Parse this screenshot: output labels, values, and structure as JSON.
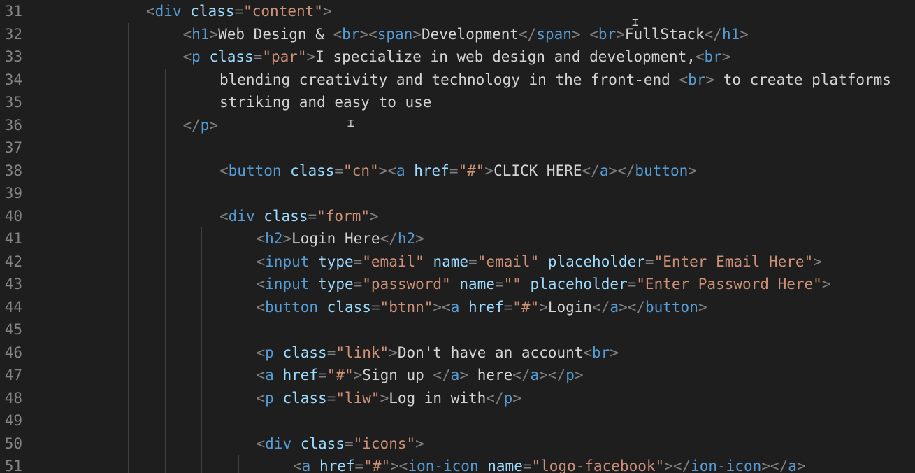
{
  "editor": {
    "colors": {
      "background": "#1e1e1e",
      "line_number": "#858585",
      "punctuation": "#808080",
      "tag": "#569cd6",
      "attribute": "#9cdcfe",
      "string": "#ce9178",
      "text": "#d4d4d4"
    },
    "lines": [
      {
        "num": "31",
        "indent": 3,
        "tokens": [
          {
            "t": "t",
            "v": "<"
          },
          {
            "t": "tg",
            "v": "div"
          },
          {
            "t": "tx",
            "v": " "
          },
          {
            "t": "at",
            "v": "class"
          },
          {
            "t": "t",
            "v": "="
          },
          {
            "t": "st",
            "v": "\"content\""
          },
          {
            "t": "t",
            "v": ">"
          }
        ]
      },
      {
        "num": "32",
        "indent": 4,
        "tokens": [
          {
            "t": "t",
            "v": "<"
          },
          {
            "t": "tg",
            "v": "h1"
          },
          {
            "t": "t",
            "v": ">"
          },
          {
            "t": "tx",
            "v": "Web Design & "
          },
          {
            "t": "t",
            "v": "<"
          },
          {
            "t": "tg",
            "v": "br"
          },
          {
            "t": "t",
            "v": ">"
          },
          {
            "t": "t",
            "v": "<"
          },
          {
            "t": "tg",
            "v": "span"
          },
          {
            "t": "t",
            "v": ">"
          },
          {
            "t": "tx",
            "v": "Development"
          },
          {
            "t": "t",
            "v": "</"
          },
          {
            "t": "tg",
            "v": "span"
          },
          {
            "t": "t",
            "v": ">"
          },
          {
            "t": "tx",
            "v": " "
          },
          {
            "t": "t",
            "v": "<"
          },
          {
            "t": "tg",
            "v": "br"
          },
          {
            "t": "t",
            "v": ">"
          },
          {
            "t": "tx",
            "v": "FullStack"
          },
          {
            "t": "t",
            "v": "</"
          },
          {
            "t": "tg",
            "v": "h1"
          },
          {
            "t": "t",
            "v": ">"
          }
        ]
      },
      {
        "num": "33",
        "indent": 4,
        "tokens": [
          {
            "t": "t",
            "v": "<"
          },
          {
            "t": "tg",
            "v": "p"
          },
          {
            "t": "tx",
            "v": " "
          },
          {
            "t": "at",
            "v": "class"
          },
          {
            "t": "t",
            "v": "="
          },
          {
            "t": "st",
            "v": "\"par\""
          },
          {
            "t": "t",
            "v": ">"
          },
          {
            "t": "tx",
            "v": "I specialize in web design and development,"
          },
          {
            "t": "t",
            "v": "<"
          },
          {
            "t": "tg",
            "v": "br"
          },
          {
            "t": "t",
            "v": ">"
          }
        ]
      },
      {
        "num": "34",
        "indent": 5,
        "tokens": [
          {
            "t": "tx",
            "v": "blending creativity and technology in the front-end "
          },
          {
            "t": "t",
            "v": "<"
          },
          {
            "t": "tg",
            "v": "br"
          },
          {
            "t": "t",
            "v": ">"
          },
          {
            "t": "tx",
            "v": " to create platforms"
          }
        ]
      },
      {
        "num": "35",
        "indent": 5,
        "tokens": [
          {
            "t": "tx",
            "v": "striking and easy to use"
          }
        ]
      },
      {
        "num": "36",
        "indent": 4,
        "tokens": [
          {
            "t": "t",
            "v": "</"
          },
          {
            "t": "tg",
            "v": "p"
          },
          {
            "t": "t",
            "v": ">"
          }
        ]
      },
      {
        "num": "37",
        "indent": 0,
        "tokens": []
      },
      {
        "num": "38",
        "indent": 5,
        "tokens": [
          {
            "t": "t",
            "v": "<"
          },
          {
            "t": "tg",
            "v": "button"
          },
          {
            "t": "tx",
            "v": " "
          },
          {
            "t": "at",
            "v": "class"
          },
          {
            "t": "t",
            "v": "="
          },
          {
            "t": "st",
            "v": "\"cn\""
          },
          {
            "t": "t",
            "v": ">"
          },
          {
            "t": "t",
            "v": "<"
          },
          {
            "t": "tg",
            "v": "a"
          },
          {
            "t": "tx",
            "v": " "
          },
          {
            "t": "at",
            "v": "href"
          },
          {
            "t": "t",
            "v": "="
          },
          {
            "t": "st",
            "v": "\"#\""
          },
          {
            "t": "t",
            "v": ">"
          },
          {
            "t": "tx",
            "v": "CLICK HERE"
          },
          {
            "t": "t",
            "v": "</"
          },
          {
            "t": "tg",
            "v": "a"
          },
          {
            "t": "t",
            "v": ">"
          },
          {
            "t": "t",
            "v": "</"
          },
          {
            "t": "tg",
            "v": "button"
          },
          {
            "t": "t",
            "v": ">"
          }
        ]
      },
      {
        "num": "39",
        "indent": 0,
        "tokens": []
      },
      {
        "num": "40",
        "indent": 5,
        "tokens": [
          {
            "t": "t",
            "v": "<"
          },
          {
            "t": "tg",
            "v": "div"
          },
          {
            "t": "tx",
            "v": " "
          },
          {
            "t": "at",
            "v": "class"
          },
          {
            "t": "t",
            "v": "="
          },
          {
            "t": "st",
            "v": "\"form\""
          },
          {
            "t": "t",
            "v": ">"
          }
        ]
      },
      {
        "num": "41",
        "indent": 6,
        "tokens": [
          {
            "t": "t",
            "v": "<"
          },
          {
            "t": "tg",
            "v": "h2"
          },
          {
            "t": "t",
            "v": ">"
          },
          {
            "t": "tx",
            "v": "Login Here"
          },
          {
            "t": "t",
            "v": "</"
          },
          {
            "t": "tg",
            "v": "h2"
          },
          {
            "t": "t",
            "v": ">"
          }
        ]
      },
      {
        "num": "42",
        "indent": 6,
        "tokens": [
          {
            "t": "t",
            "v": "<"
          },
          {
            "t": "tg",
            "v": "input"
          },
          {
            "t": "tx",
            "v": " "
          },
          {
            "t": "at",
            "v": "type"
          },
          {
            "t": "t",
            "v": "="
          },
          {
            "t": "st",
            "v": "\"email\""
          },
          {
            "t": "tx",
            "v": " "
          },
          {
            "t": "at",
            "v": "name"
          },
          {
            "t": "t",
            "v": "="
          },
          {
            "t": "st",
            "v": "\"email\""
          },
          {
            "t": "tx",
            "v": " "
          },
          {
            "t": "at",
            "v": "placeholder"
          },
          {
            "t": "t",
            "v": "="
          },
          {
            "t": "st",
            "v": "\"Enter Email Here\""
          },
          {
            "t": "t",
            "v": ">"
          }
        ]
      },
      {
        "num": "43",
        "indent": 6,
        "tokens": [
          {
            "t": "t",
            "v": "<"
          },
          {
            "t": "tg",
            "v": "input"
          },
          {
            "t": "tx",
            "v": " "
          },
          {
            "t": "at",
            "v": "type"
          },
          {
            "t": "t",
            "v": "="
          },
          {
            "t": "st",
            "v": "\"password\""
          },
          {
            "t": "tx",
            "v": " "
          },
          {
            "t": "at",
            "v": "name"
          },
          {
            "t": "t",
            "v": "="
          },
          {
            "t": "st",
            "v": "\"\""
          },
          {
            "t": "tx",
            "v": " "
          },
          {
            "t": "at",
            "v": "placeholder"
          },
          {
            "t": "t",
            "v": "="
          },
          {
            "t": "st",
            "v": "\"Enter Password Here\""
          },
          {
            "t": "t",
            "v": ">"
          }
        ]
      },
      {
        "num": "44",
        "indent": 6,
        "tokens": [
          {
            "t": "t",
            "v": "<"
          },
          {
            "t": "tg",
            "v": "button"
          },
          {
            "t": "tx",
            "v": " "
          },
          {
            "t": "at",
            "v": "class"
          },
          {
            "t": "t",
            "v": "="
          },
          {
            "t": "st",
            "v": "\"btnn\""
          },
          {
            "t": "t",
            "v": ">"
          },
          {
            "t": "t",
            "v": "<"
          },
          {
            "t": "tg",
            "v": "a"
          },
          {
            "t": "tx",
            "v": " "
          },
          {
            "t": "at",
            "v": "href"
          },
          {
            "t": "t",
            "v": "="
          },
          {
            "t": "st",
            "v": "\"#\""
          },
          {
            "t": "t",
            "v": ">"
          },
          {
            "t": "tx",
            "v": "Login"
          },
          {
            "t": "t",
            "v": "</"
          },
          {
            "t": "tg",
            "v": "a"
          },
          {
            "t": "t",
            "v": ">"
          },
          {
            "t": "t",
            "v": "</"
          },
          {
            "t": "tg",
            "v": "button"
          },
          {
            "t": "t",
            "v": ">"
          }
        ]
      },
      {
        "num": "45",
        "indent": 0,
        "tokens": []
      },
      {
        "num": "46",
        "indent": 6,
        "tokens": [
          {
            "t": "t",
            "v": "<"
          },
          {
            "t": "tg",
            "v": "p"
          },
          {
            "t": "tx",
            "v": " "
          },
          {
            "t": "at",
            "v": "class"
          },
          {
            "t": "t",
            "v": "="
          },
          {
            "t": "st",
            "v": "\"link\""
          },
          {
            "t": "t",
            "v": ">"
          },
          {
            "t": "tx",
            "v": "Don't have an account"
          },
          {
            "t": "t",
            "v": "<"
          },
          {
            "t": "tg",
            "v": "br"
          },
          {
            "t": "t",
            "v": ">"
          }
        ]
      },
      {
        "num": "47",
        "indent": 6,
        "tokens": [
          {
            "t": "t",
            "v": "<"
          },
          {
            "t": "tg",
            "v": "a"
          },
          {
            "t": "tx",
            "v": " "
          },
          {
            "t": "at",
            "v": "href"
          },
          {
            "t": "t",
            "v": "="
          },
          {
            "t": "st",
            "v": "\"#\""
          },
          {
            "t": "t",
            "v": ">"
          },
          {
            "t": "tx",
            "v": "Sign up "
          },
          {
            "t": "t",
            "v": "</"
          },
          {
            "t": "tg",
            "v": "a"
          },
          {
            "t": "t",
            "v": ">"
          },
          {
            "t": "tx",
            "v": " here"
          },
          {
            "t": "t",
            "v": "</"
          },
          {
            "t": "tg",
            "v": "a"
          },
          {
            "t": "t",
            "v": ">"
          },
          {
            "t": "t",
            "v": "</"
          },
          {
            "t": "tg",
            "v": "p"
          },
          {
            "t": "t",
            "v": ">"
          }
        ]
      },
      {
        "num": "48",
        "indent": 6,
        "tokens": [
          {
            "t": "t",
            "v": "<"
          },
          {
            "t": "tg",
            "v": "p"
          },
          {
            "t": "tx",
            "v": " "
          },
          {
            "t": "at",
            "v": "class"
          },
          {
            "t": "t",
            "v": "="
          },
          {
            "t": "st",
            "v": "\"liw\""
          },
          {
            "t": "t",
            "v": ">"
          },
          {
            "t": "tx",
            "v": "Log in with"
          },
          {
            "t": "t",
            "v": "</"
          },
          {
            "t": "tg",
            "v": "p"
          },
          {
            "t": "t",
            "v": ">"
          }
        ]
      },
      {
        "num": "49",
        "indent": 0,
        "tokens": []
      },
      {
        "num": "50",
        "indent": 6,
        "tokens": [
          {
            "t": "t",
            "v": "<"
          },
          {
            "t": "tg",
            "v": "div"
          },
          {
            "t": "tx",
            "v": " "
          },
          {
            "t": "at",
            "v": "class"
          },
          {
            "t": "t",
            "v": "="
          },
          {
            "t": "st",
            "v": "\"icons\""
          },
          {
            "t": "t",
            "v": ">"
          }
        ]
      },
      {
        "num": "51",
        "indent": 7,
        "tokens": [
          {
            "t": "t",
            "v": "<"
          },
          {
            "t": "tg",
            "v": "a"
          },
          {
            "t": "tx",
            "v": " "
          },
          {
            "t": "at",
            "v": "href"
          },
          {
            "t": "t",
            "v": "="
          },
          {
            "t": "st",
            "v": "\"#\""
          },
          {
            "t": "t",
            "v": ">"
          },
          {
            "t": "t",
            "v": "<"
          },
          {
            "t": "tg",
            "v": "ion-icon"
          },
          {
            "t": "tx",
            "v": " "
          },
          {
            "t": "at",
            "v": "name"
          },
          {
            "t": "t",
            "v": "="
          },
          {
            "t": "st",
            "v": "\"logo-facebook\""
          },
          {
            "t": "t",
            "v": ">"
          },
          {
            "t": "t",
            "v": "</"
          },
          {
            "t": "tg",
            "v": "ion-icon"
          },
          {
            "t": "t",
            "v": ">"
          },
          {
            "t": "t",
            "v": "</"
          },
          {
            "t": "tg",
            "v": "a"
          },
          {
            "t": "t",
            "v": ">"
          }
        ]
      }
    ]
  }
}
